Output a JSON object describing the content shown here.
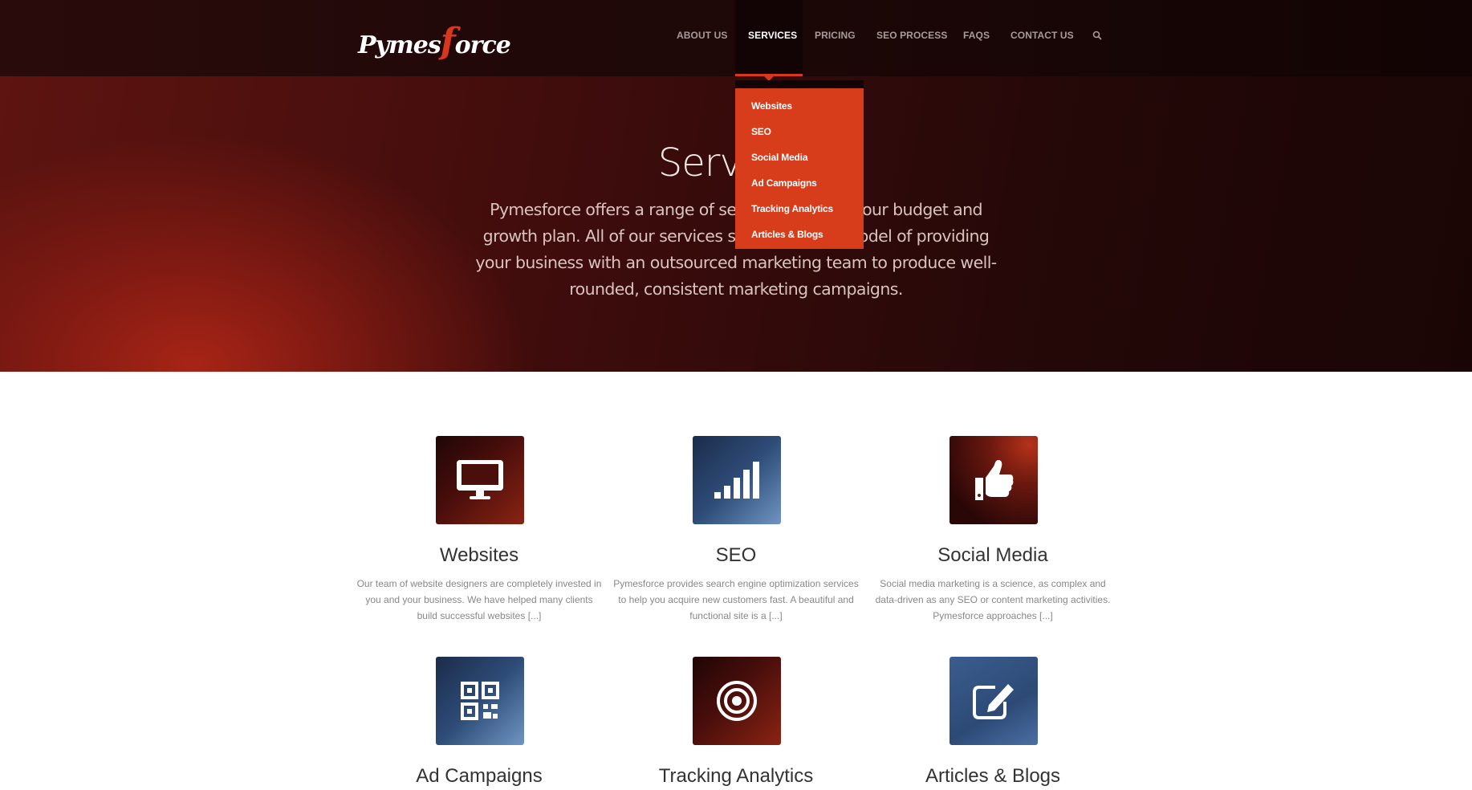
{
  "header": {
    "logo": {
      "left": "Pymes",
      "mid": "f",
      "right": "orce"
    },
    "nav": [
      "ABOUT US",
      "SERVICES",
      "PRICING",
      "SEO PROCESS",
      "FAQS",
      "CONTACT US"
    ],
    "active_nav": "SERVICES"
  },
  "dropdown": [
    "Websites",
    "SEO",
    "Social Media",
    "Ad Campaigns",
    "Tracking Analytics",
    "Articles & Blogs"
  ],
  "hero": {
    "title": "Services",
    "text": "Pymesforce offers a range of services to meet your budget and growth plan. All of our services stem from our model of providing your business with an outsourced marketing team to produce well-rounded, consistent marketing campaigns."
  },
  "services": [
    {
      "title": "Websites",
      "desc": "Our team of website designers are completely invested in you and your business. We have helped many clients build successful websites [...]",
      "icon": "monitor-icon"
    },
    {
      "title": "SEO",
      "desc": "Pymesforce provides search engine optimization services to help you acquire new customers fast. A beautiful and functional site is a [...]",
      "icon": "signal-bars-icon"
    },
    {
      "title": "Social Media",
      "desc": "Social media marketing is a science, as complex and data-driven as any SEO or content marketing activities. Pymesforce approaches [...]",
      "icon": "thumbs-up-icon"
    },
    {
      "title": "Ad Campaigns",
      "icon": "qr-code-icon"
    },
    {
      "title": "Tracking Analytics",
      "icon": "target-icon"
    },
    {
      "title": "Articles & Blogs",
      "icon": "edit-icon"
    }
  ],
  "colors": {
    "accent": "#d83d1b",
    "header_bg": "#1c0707"
  }
}
